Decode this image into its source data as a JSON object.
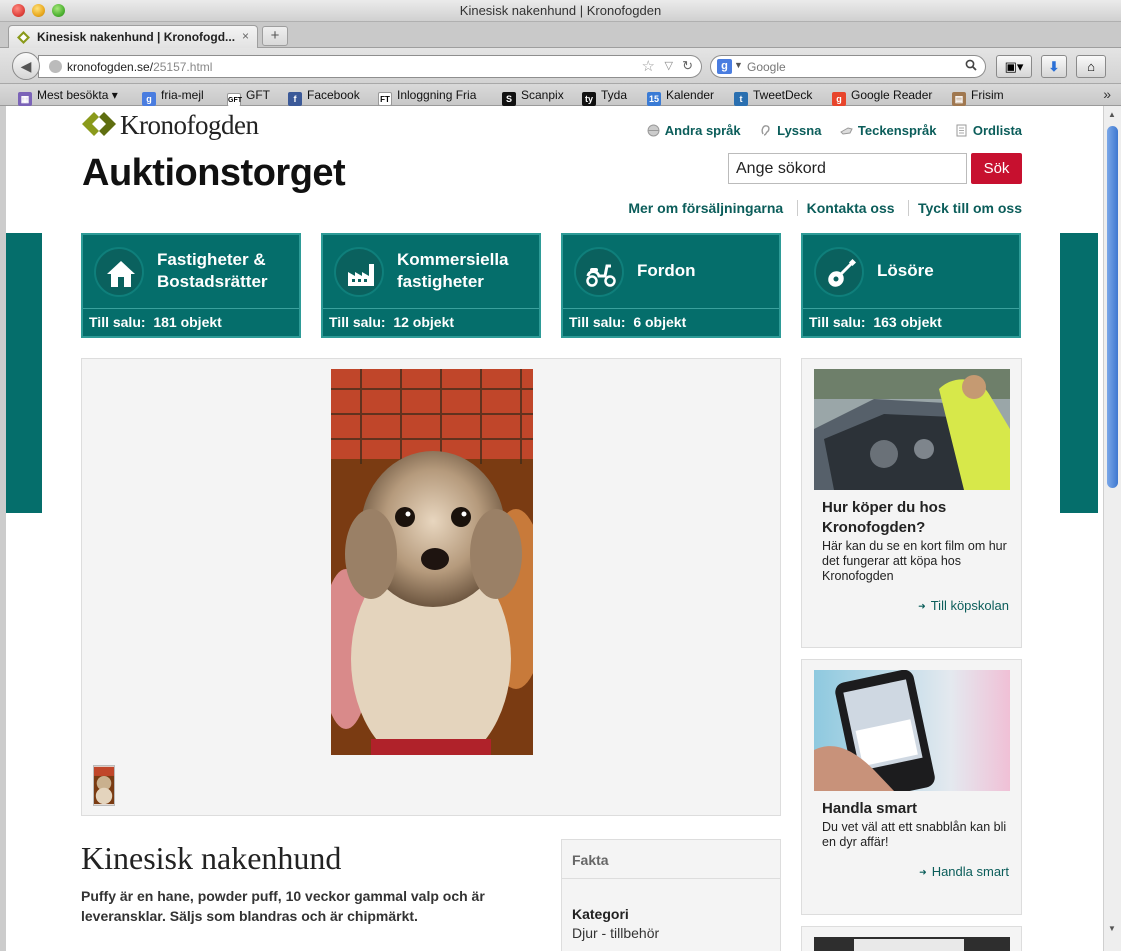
{
  "window": {
    "title": "Kinesisk nakenhund | Kronofogden"
  },
  "tab": {
    "title": "Kinesisk nakenhund | Kronofogd...",
    "close": "×",
    "new_tab": "+"
  },
  "urlbar": {
    "host": "kronofogden.se/",
    "path": "25157.html"
  },
  "search_bar": {
    "placeholder": "Google",
    "engine_letter": "g"
  },
  "bookmarks": [
    {
      "label": "Mest besökta",
      "icon": "most-visited-icon",
      "color": "#7b63b8"
    },
    {
      "label": "fria-mejl",
      "icon": "google-icon",
      "color": "#4a7de0"
    },
    {
      "label": "GFT",
      "icon": "gft-icon",
      "color": "#ffffff"
    },
    {
      "label": "Facebook",
      "icon": "facebook-icon",
      "color": "#3b5998"
    },
    {
      "label": "Inloggning Fria",
      "icon": "ft-icon",
      "color": "#ffffff"
    },
    {
      "label": "Scanpix",
      "icon": "scanpix-icon",
      "color": "#111111"
    },
    {
      "label": "Tyda",
      "icon": "tyda-icon",
      "color": "#111111"
    },
    {
      "label": "Kalender",
      "icon": "calendar-icon",
      "color": "#3a7bd5"
    },
    {
      "label": "TweetDeck",
      "icon": "tweetdeck-icon",
      "color": "#2a6fb0"
    },
    {
      "label": "Google Reader",
      "icon": "google-reader-icon",
      "color": "#e8452c"
    },
    {
      "label": "Frisim",
      "icon": "frisim-icon",
      "color": "#a07850"
    }
  ],
  "bookmarks_more": "»",
  "site": {
    "logo_text": "Kronofogden",
    "title": "Auktionstorget",
    "top_links": [
      {
        "label": "Andra språk",
        "icon": "globe-icon"
      },
      {
        "label": "Lyssna",
        "icon": "ear-icon"
      },
      {
        "label": "Teckenspråk",
        "icon": "sign-language-icon"
      },
      {
        "label": "Ordlista",
        "icon": "document-icon"
      }
    ],
    "search": {
      "value": "Ange sökord",
      "button": "Sök"
    },
    "sub_links": [
      "Mer om försäljningarna",
      "Kontakta oss",
      "Tyck till om oss"
    ]
  },
  "categories": [
    {
      "name": "Fastigheter &",
      "name2": "Bostadsrätter",
      "label": "Till salu:",
      "count": "181 objekt",
      "icon": "house-icon"
    },
    {
      "name": "Kommersiella",
      "name2": "fastigheter",
      "label": "Till salu:",
      "count": "12 objekt",
      "icon": "factory-icon"
    },
    {
      "name": "Fordon",
      "name2": "",
      "label": "Till salu:",
      "count": "6 objekt",
      "icon": "scooter-icon"
    },
    {
      "name": "Lösöre",
      "name2": "",
      "label": "Till salu:",
      "count": "163 objekt",
      "icon": "guitar-icon"
    }
  ],
  "item": {
    "title": "Kinesisk nakenhund",
    "description": "Puffy är en hane, powder puff, 10 veckor gammal valp och är leveransklar. Säljs som blandras och är chipmärkt."
  },
  "facts": {
    "heading": "Fakta",
    "label": "Kategori",
    "value": "Djur - tillbehör"
  },
  "side_cards": [
    {
      "title": "Hur köper du hos Kronofogden?",
      "text": "Här kan du se en kort film om hur det fungerar att köpa hos Kronofogden",
      "link": "Till köpskolan"
    },
    {
      "title": "Handla smart",
      "text": "Du vet väl att ett snabblån kan bli en dyr affär!",
      "link": "Handla smart"
    }
  ],
  "colors": {
    "brand_teal": "#056e6b",
    "search_red": "#c7102f",
    "link_teal": "#0b5d5a"
  }
}
